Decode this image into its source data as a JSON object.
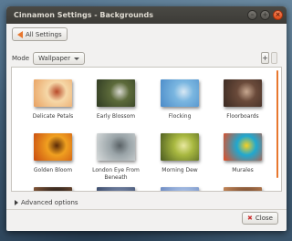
{
  "window": {
    "title": "Cinnamon Settings - Backgrounds"
  },
  "titlebar_buttons": {
    "minimize": "–",
    "maximize": "+",
    "close": "×"
  },
  "toolbar": {
    "all_settings_label": "All Settings"
  },
  "mode": {
    "label": "Mode",
    "selected": "Wallpaper"
  },
  "list_controls": {
    "add": "+",
    "remove": ""
  },
  "wallpapers": [
    {
      "label": "Delicate Petals",
      "colors": [
        "#f6d8a8",
        "#e8a060",
        "#b84a2a"
      ]
    },
    {
      "label": "Early Blossom",
      "colors": [
        "#5c6a3a",
        "#2f3a22",
        "#d8d8d0"
      ]
    },
    {
      "label": "Flocking",
      "colors": [
        "#7ab6e0",
        "#4a8ac8",
        "#d8e8f4"
      ]
    },
    {
      "label": "Floorboards",
      "colors": [
        "#6a4a3a",
        "#3a2a22",
        "#c8a890"
      ]
    },
    {
      "label": "Golden Bloom",
      "colors": [
        "#f0a020",
        "#c84a10",
        "#5a2a08"
      ]
    },
    {
      "label": "London Eye From Beneath",
      "colors": [
        "#9aa4a8",
        "#d8dcdc",
        "#5a6266"
      ]
    },
    {
      "label": "Morning Dew",
      "colors": [
        "#a8b840",
        "#4a5a20",
        "#e8e8a0"
      ]
    },
    {
      "label": "Murales",
      "colors": [
        "#20a8d0",
        "#e84a20",
        "#f8d020"
      ]
    },
    {
      "label": "",
      "colors": [
        "#3a2a20",
        "#8a5a3a",
        "#222222"
      ]
    },
    {
      "label": "",
      "colors": [
        "#6a7a9a",
        "#3a4a6a",
        "#a0a8c0"
      ]
    },
    {
      "label": "",
      "colors": [
        "#a0b8e0",
        "#6a88c0",
        "#e0e8f8"
      ]
    },
    {
      "label": "",
      "colors": [
        "#8a5a3a",
        "#c88a5a",
        "#3a2a1a"
      ]
    }
  ],
  "advanced": {
    "label": "Advanced options"
  },
  "footer": {
    "close_label": "Close"
  },
  "accent": "#e8772e"
}
